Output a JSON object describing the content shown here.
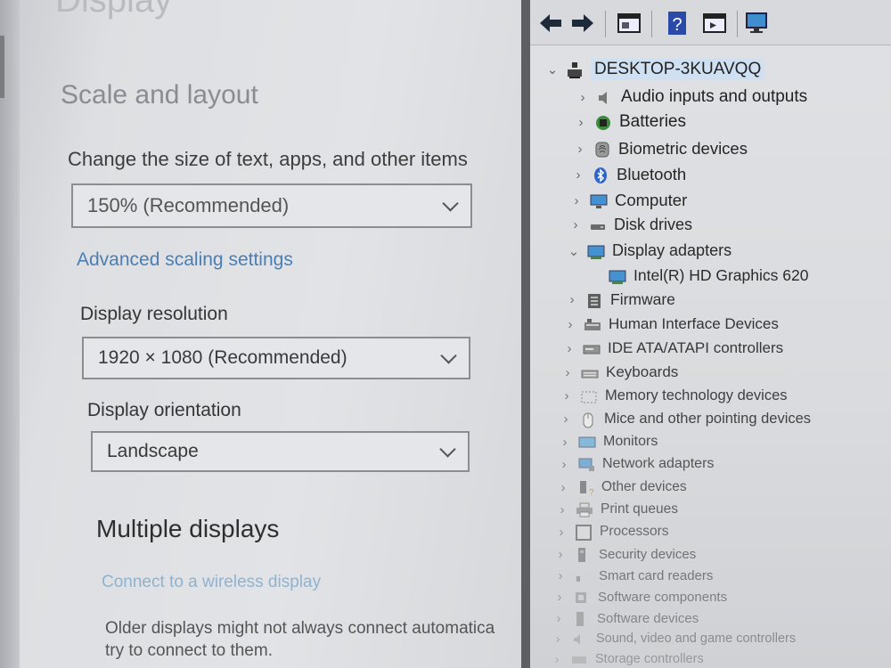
{
  "settings": {
    "page_heading": "Display",
    "section_scale": "Scale and layout",
    "size_label": "Change the size of text, apps, and other items",
    "size_value": "150% (Recommended)",
    "advanced_link": "Advanced scaling settings",
    "resolution_label": "Display resolution",
    "resolution_value": "1920 × 1080 (Recommended)",
    "orientation_label": "Display orientation",
    "orientation_value": "Landscape",
    "section_multiple": "Multiple displays",
    "wireless_link": "Connect to a wireless display",
    "older_text_line1": "Older displays might not always connect automatica",
    "older_text_line2": "try to connect to them."
  },
  "devmgr": {
    "toolbar": [
      "back-icon",
      "forward-icon",
      "properties-icon",
      "help-icon",
      "action-icon",
      "scan-icon"
    ],
    "computer_name": "DESKTOP-3KUAVQQ",
    "categories": [
      {
        "label": "Audio inputs and outputs",
        "icon": "speaker-icon",
        "expanded": false
      },
      {
        "label": "Batteries",
        "icon": "battery-icon",
        "expanded": false
      },
      {
        "label": "Biometric devices",
        "icon": "fingerprint-icon",
        "expanded": false
      },
      {
        "label": "Bluetooth",
        "icon": "bluetooth-icon",
        "expanded": false
      },
      {
        "label": "Computer",
        "icon": "computer-icon",
        "expanded": false
      },
      {
        "label": "Disk drives",
        "icon": "disk-icon",
        "expanded": false
      },
      {
        "label": "Display adapters",
        "icon": "display-adapter-icon",
        "expanded": true
      },
      {
        "label": "Intel(R) HD Graphics 620",
        "icon": "display-adapter-icon",
        "child": true
      },
      {
        "label": "Firmware",
        "icon": "firmware-icon",
        "expanded": false
      },
      {
        "label": "Human Interface Devices",
        "icon": "hid-icon",
        "expanded": false
      },
      {
        "label": "IDE ATA/ATAPI controllers",
        "icon": "ide-icon",
        "expanded": false
      },
      {
        "label": "Keyboards",
        "icon": "keyboard-icon",
        "expanded": false
      },
      {
        "label": "Memory technology devices",
        "icon": "memory-icon",
        "expanded": false
      },
      {
        "label": "Mice and other pointing devices",
        "icon": "mouse-icon",
        "expanded": false
      },
      {
        "label": "Monitors",
        "icon": "monitor-icon",
        "expanded": false
      },
      {
        "label": "Network adapters",
        "icon": "network-icon",
        "expanded": false
      },
      {
        "label": "Other devices",
        "icon": "other-devices-icon",
        "expanded": false
      },
      {
        "label": "Print queues",
        "icon": "printer-icon",
        "expanded": false
      },
      {
        "label": "Processors",
        "icon": "processor-icon",
        "expanded": false
      },
      {
        "label": "Security devices",
        "icon": "security-icon",
        "expanded": false
      },
      {
        "label": "Smart card readers",
        "icon": "smartcard-icon",
        "expanded": false
      },
      {
        "label": "Software components",
        "icon": "software-component-icon",
        "expanded": false
      },
      {
        "label": "Software devices",
        "icon": "software-device-icon",
        "expanded": false
      },
      {
        "label": "Sound, video and game controllers",
        "icon": "sound-icon",
        "expanded": false
      },
      {
        "label": "Storage controllers",
        "icon": "storage-icon",
        "expanded": false
      }
    ]
  },
  "colors": {
    "link": "#4a7fb5",
    "selection": "#cfe0f2",
    "monitor_blue": "#3f8fd0"
  }
}
